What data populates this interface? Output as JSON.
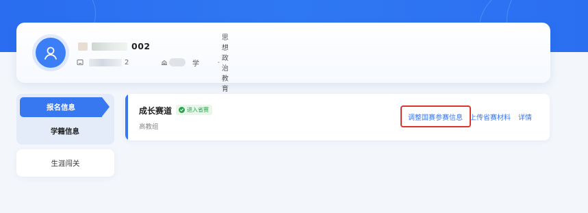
{
  "profile": {
    "name_suffix": "002",
    "id_suffix": "2",
    "school_suffix": "学",
    "major": "思想政治教育"
  },
  "sidebar": {
    "items": [
      {
        "label": "报名信息",
        "active": true
      },
      {
        "label": "学籍信息",
        "active": false
      },
      {
        "label": "生涯闯关",
        "active": false
      }
    ]
  },
  "entry": {
    "title": "成长赛道",
    "status": "进入省赛",
    "group": "高教组",
    "actions": {
      "adjust": "调整国赛参赛信息",
      "upload": "上传省赛材料",
      "details": "详情"
    }
  },
  "colors": {
    "brand": "#3777ef",
    "status_green": "#2ba24c",
    "highlight": "#d9362b"
  }
}
